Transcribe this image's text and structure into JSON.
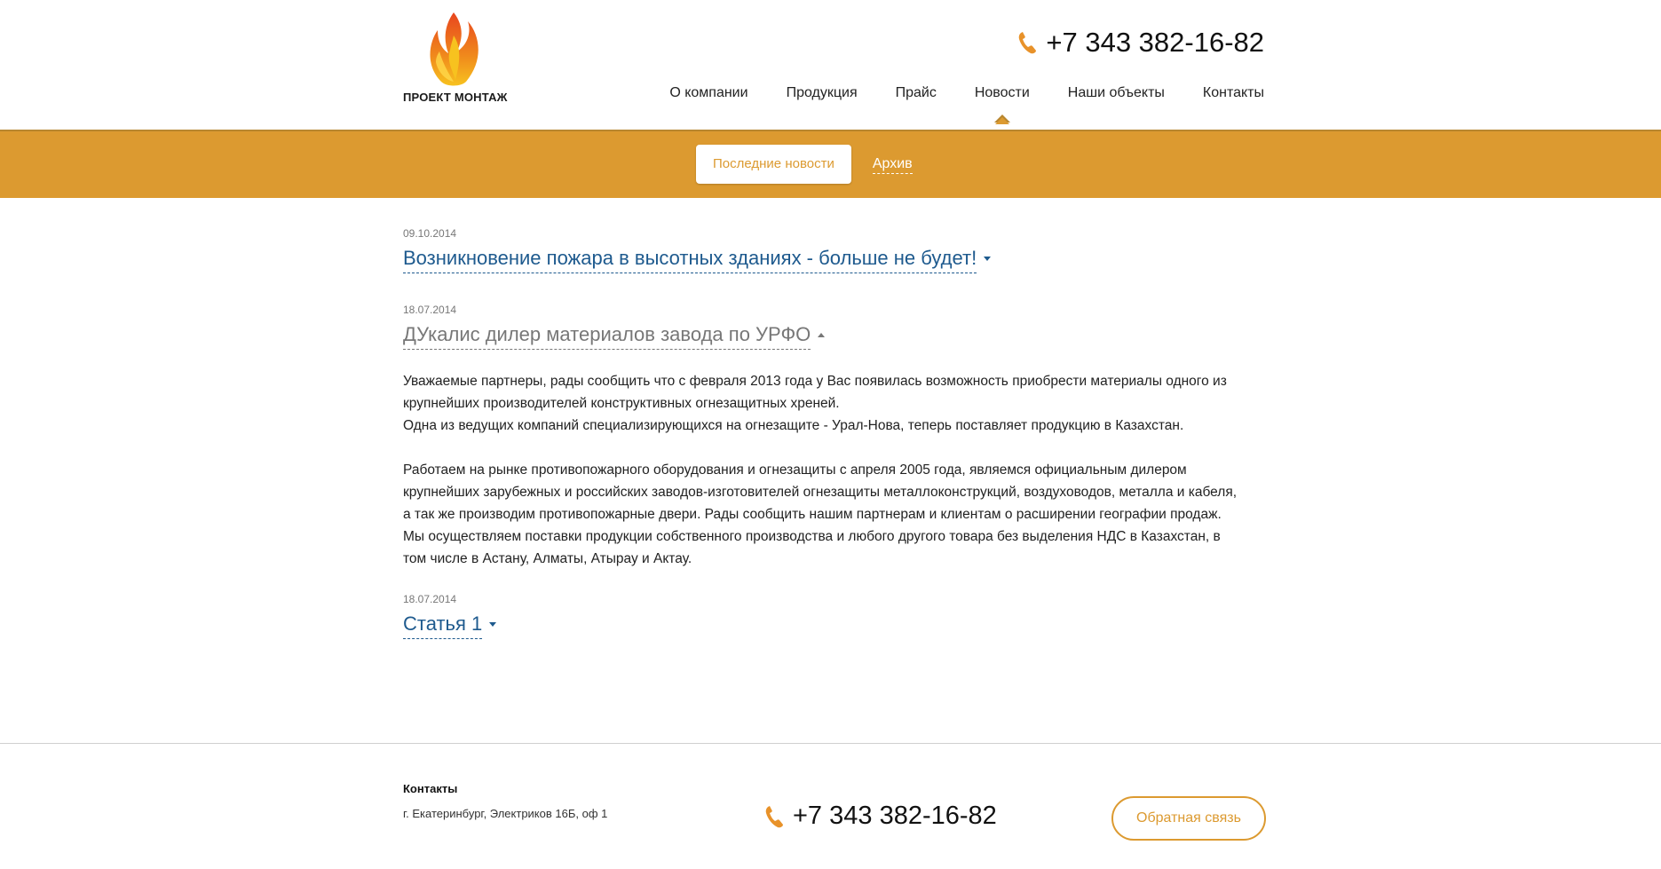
{
  "brand": {
    "name": "ПРОЕКТ МОНТАЖ"
  },
  "header": {
    "phone": "+7 343 382-16-82",
    "nav": [
      {
        "label": "О компании"
      },
      {
        "label": "Продукция"
      },
      {
        "label": "Прайс"
      },
      {
        "label": "Новости",
        "active": true
      },
      {
        "label": "Наши объекты"
      },
      {
        "label": "Контакты"
      }
    ]
  },
  "subnav": {
    "active_label": "Последние новости",
    "archive_label": "Архив"
  },
  "news": [
    {
      "date": "09.10.2014",
      "title": "Возникновение пожара в высотных зданиях - больше не будет!",
      "open": false
    },
    {
      "date": "18.07.2014",
      "title": "ДУкалис дилер материалов завода по УРФО",
      "open": true,
      "paragraph1": "Уважаемые партнеры, рады сообщить что с февраля 2013 года у Вас появилась возможность приобрести материалы одного из крупнейших производителей конструктивных огнезащитных хреней.",
      "paragraph1b": "Одна из ведущих компаний специализирующихся на огнезащите - Урал-Нова, теперь поставляет продукцию в Казахстан.",
      "paragraph2": "Работаем на рынке противопожарного оборудования и огнезащиты с апреля 2005 года, являемся официальным дилером крупнейших зарубежных и российских заводов-изготовителей огнезащиты металлоконструкций, воздуховодов, металла и кабеля, а так же производим противопожарные двери. Рады сообщить нашим партнерам и клиентам о расширении географии продаж. Мы осуществляем поставки продукции собственного производства и любого другого товара без выделения НДС в Казахстан, в том числе в Астану, Алматы, Атырау и Актау."
    },
    {
      "date": "18.07.2014",
      "title": "Статья 1",
      "open": false
    }
  ],
  "footer": {
    "contacts_title": "Контакты",
    "address": "г. Екатеринбург, Электриков 16Б, оф 1",
    "phone": "+7 343 382-16-82",
    "feedback_label": "Обратная связь"
  },
  "colors": {
    "accent": "#dc9a30",
    "link": "#1e5a8e"
  },
  "icons": {
    "phone": "phone-icon",
    "logo": "flame-logo-icon",
    "caret_down": "caret-down-icon",
    "caret_up": "caret-up-icon"
  }
}
